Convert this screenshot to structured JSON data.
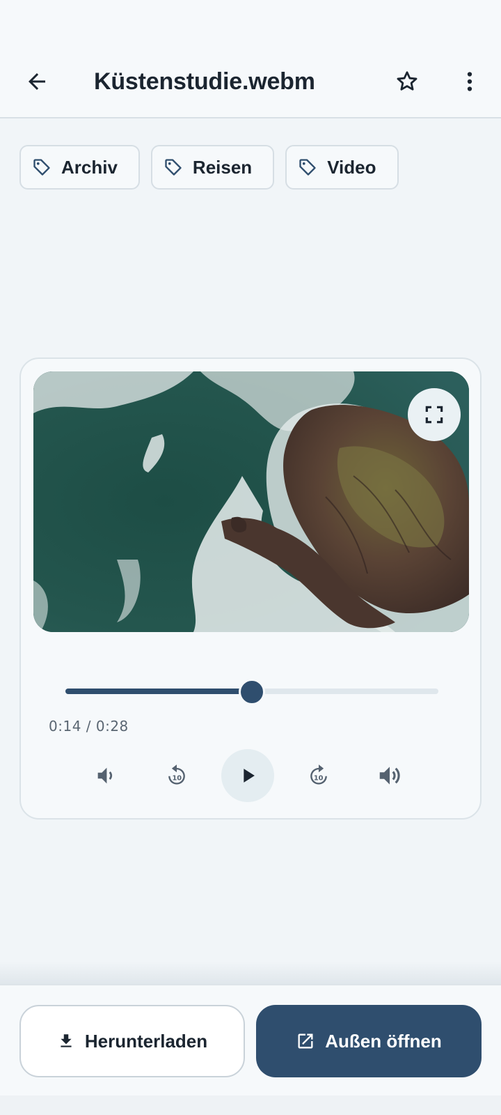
{
  "header": {
    "title": "Küstenstudie.webm",
    "back_icon": "arrow-left-icon",
    "favorite_icon": "star-outline-icon",
    "more_icon": "more-vertical-icon"
  },
  "tags": [
    {
      "label": "Archiv",
      "icon": "tag-icon"
    },
    {
      "label": "Reisen",
      "icon": "tag-icon"
    },
    {
      "label": "Video",
      "icon": "tag-icon"
    }
  ],
  "player": {
    "current_time": "0:14",
    "duration": "0:28",
    "time_text": "0:14 / 0:28",
    "progress_fraction": 0.5,
    "controls": [
      "volume-down-icon",
      "replay-10-icon",
      "play-icon",
      "forward-10-icon",
      "volume-up-icon"
    ],
    "fullscreen_icon": "fullscreen-icon"
  },
  "actions": {
    "download_label": "Herunterladen",
    "download_icon": "download-icon",
    "open_external_label": "Außen öffnen",
    "open_external_icon": "open-external-icon"
  },
  "colors": {
    "accent": "#2f4e6e",
    "background": "#f1f5f8"
  }
}
